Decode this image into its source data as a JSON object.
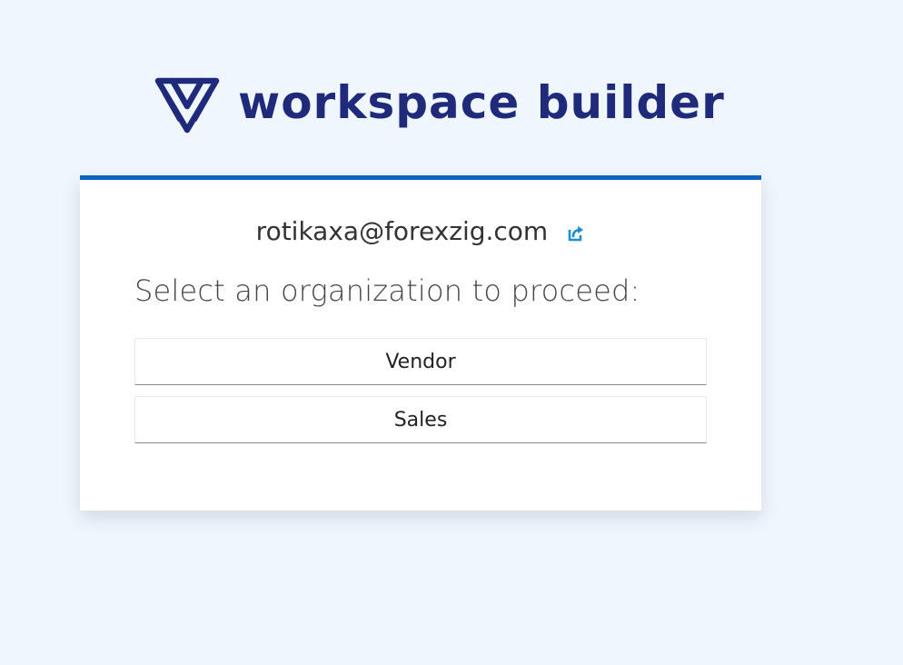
{
  "brand": {
    "name": "workspace builder",
    "logo_icon": "workspace-builder-logo-icon",
    "color": "#1f2a7b"
  },
  "account": {
    "email": "rotikaxa@forexzig.com",
    "switch_icon": "external-link-icon"
  },
  "prompt": "Select an organization to proceed:",
  "organizations": [
    {
      "label": "Vendor"
    },
    {
      "label": "Sales"
    }
  ],
  "colors": {
    "page_background": "#eff6fe",
    "card_accent": "#0b63c1",
    "link": "#1a8fd1"
  }
}
